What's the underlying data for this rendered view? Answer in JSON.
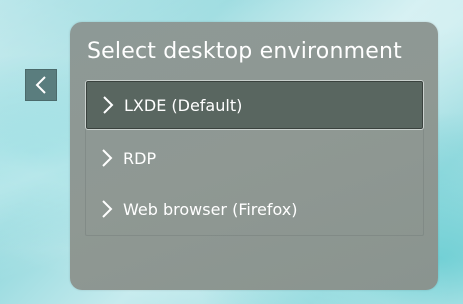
{
  "dialog": {
    "title": "Select desktop environment",
    "back_icon": "chevron-left-icon",
    "options": [
      {
        "label": "LXDE (Default)",
        "icon": "chevron-right-icon",
        "selected": true
      },
      {
        "label": "RDP",
        "icon": "chevron-right-icon",
        "selected": false
      },
      {
        "label": "Web browser (Firefox)",
        "icon": "chevron-right-icon",
        "selected": false
      }
    ]
  },
  "colors": {
    "panel": "#8f9893",
    "selected_row": "#596660",
    "back_button": "#5a7d7e",
    "text": "#ffffff"
  }
}
